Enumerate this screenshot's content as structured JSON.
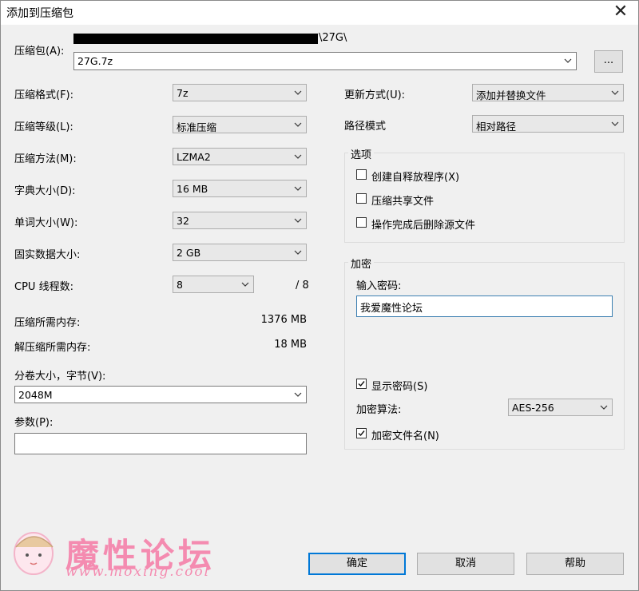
{
  "window": {
    "title": "添加到压缩包"
  },
  "archive": {
    "label": "压缩包(A):",
    "path_suffix": "\\27G\\",
    "filename": "27G.7z",
    "browse_label": "..."
  },
  "left": {
    "format": {
      "label": "压缩格式(F):",
      "value": "7z"
    },
    "level": {
      "label": "压缩等级(L):",
      "value": "标准压缩"
    },
    "method": {
      "label": "压缩方法(M):",
      "value": "LZMA2"
    },
    "dict": {
      "label": "字典大小(D):",
      "value": "16 MB"
    },
    "word": {
      "label": "单词大小(W):",
      "value": "32"
    },
    "solid": {
      "label": "固实数据大小:",
      "value": "2 GB"
    },
    "threads": {
      "label": "CPU 线程数:",
      "value": "8",
      "max": "/ 8"
    },
    "mem_compress": {
      "label": "压缩所需内存:",
      "value": "1376 MB"
    },
    "mem_decompress": {
      "label": "解压缩所需内存:",
      "value": "18 MB"
    },
    "volume": {
      "label": "分卷大小，字节(V):",
      "value": "2048M"
    },
    "params": {
      "label": "参数(P):",
      "value": ""
    }
  },
  "right": {
    "update": {
      "label": "更新方式(U):",
      "value": "添加并替换文件"
    },
    "pathmode": {
      "label": "路径模式",
      "value": "相对路径"
    },
    "options": {
      "title": "选项",
      "sfx": {
        "label": "创建自释放程序(X)",
        "checked": false
      },
      "shared": {
        "label": "压缩共享文件",
        "checked": false
      },
      "delete": {
        "label": "操作完成后删除源文件",
        "checked": false
      }
    },
    "encryption": {
      "title": "加密",
      "password_label": "输入密码:",
      "password": "我爱魔性论坛",
      "show_password": {
        "label": "显示密码(S)",
        "checked": true
      },
      "method_label": "加密算法:",
      "method_value": "AES-256",
      "encrypt_names": {
        "label": "加密文件名(N)",
        "checked": true
      }
    }
  },
  "buttons": {
    "ok": "确定",
    "cancel": "取消",
    "help": "帮助"
  },
  "watermark": {
    "text": "魔性论坛",
    "url": "www.moxing.cool"
  },
  "colors": {
    "accent": "#0078d7",
    "watermark": "#f48bb0"
  }
}
